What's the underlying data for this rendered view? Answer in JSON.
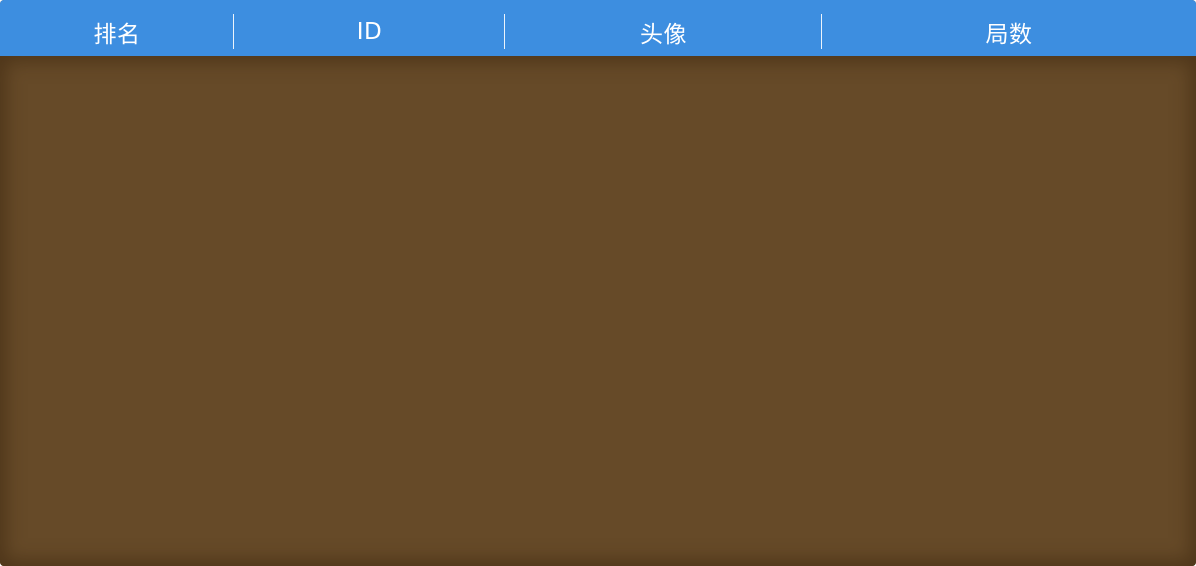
{
  "table": {
    "headers": [
      "排名",
      "ID",
      "头像",
      "局数"
    ],
    "rows": []
  },
  "colors": {
    "header_bg": "#3d8ee0",
    "header_text": "#ffffff",
    "body_bg": "#664a28"
  }
}
